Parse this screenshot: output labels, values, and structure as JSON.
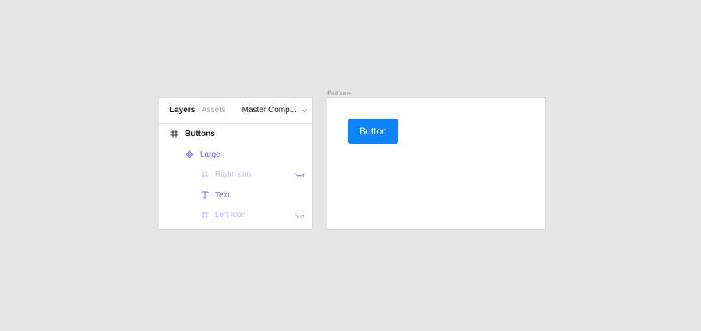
{
  "colors": {
    "background": "#e5e5e5",
    "component_purple": "#7b61ff",
    "component_purple_faded": "#c8bcfb",
    "button_blue": "#0d84fd"
  },
  "layers_panel": {
    "tabs": [
      {
        "label": "Layers",
        "active": true
      },
      {
        "label": "Assets",
        "active": false
      }
    ],
    "page_selector": {
      "value": "Master Comp...",
      "icon": "chevron-down-icon"
    },
    "layers": [
      {
        "label": "Buttons",
        "icon": "frame-icon",
        "depth": 0,
        "hidden": false
      },
      {
        "label": "Large",
        "icon": "component-icon",
        "depth": 1,
        "hidden": false
      },
      {
        "label": "Right Icon",
        "icon": "frame-icon",
        "depth": 2,
        "hidden": true
      },
      {
        "label": "Text",
        "icon": "text-icon",
        "depth": 2,
        "hidden": false
      },
      {
        "label": "Left Icon",
        "icon": "frame-icon",
        "depth": 2,
        "hidden": true
      }
    ]
  },
  "canvas": {
    "frame_label": "Buttons",
    "button_label": "Button"
  }
}
